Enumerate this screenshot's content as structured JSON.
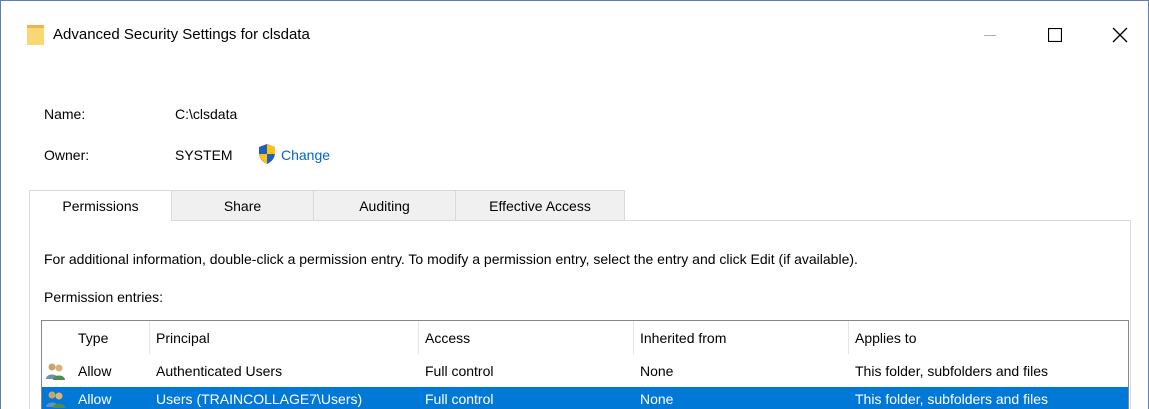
{
  "window": {
    "title": "Advanced Security Settings for clsdata"
  },
  "info": {
    "name_label": "Name:",
    "name_value": "C:\\clsdata",
    "owner_label": "Owner:",
    "owner_value": "SYSTEM",
    "change_link": "Change"
  },
  "tabs": [
    {
      "label": "Permissions",
      "active": true
    },
    {
      "label": "Share",
      "active": false
    },
    {
      "label": "Auditing",
      "active": false
    },
    {
      "label": "Effective Access",
      "active": false
    }
  ],
  "permissions": {
    "instructions": "For additional information, double-click a permission entry. To modify a permission entry, select the entry and click Edit (if available).",
    "entries_label": "Permission entries:",
    "columns": [
      "Type",
      "Principal",
      "Access",
      "Inherited from",
      "Applies to"
    ],
    "rows": [
      {
        "icon": "users-icon",
        "type": "Allow",
        "principal": "Authenticated Users",
        "access": "Full control",
        "inherited": "None",
        "applies": "This folder, subfolders and files",
        "selected": false
      },
      {
        "icon": "users-icon",
        "type": "Allow",
        "principal": "Users (TRAINCOLLAGE7\\Users)",
        "access": "Full control",
        "inherited": "None",
        "applies": "This folder, subfolders and files",
        "selected": true
      }
    ]
  },
  "colors": {
    "selection": "#0078d7",
    "link": "#0066cc",
    "folder": "#f8d775"
  }
}
